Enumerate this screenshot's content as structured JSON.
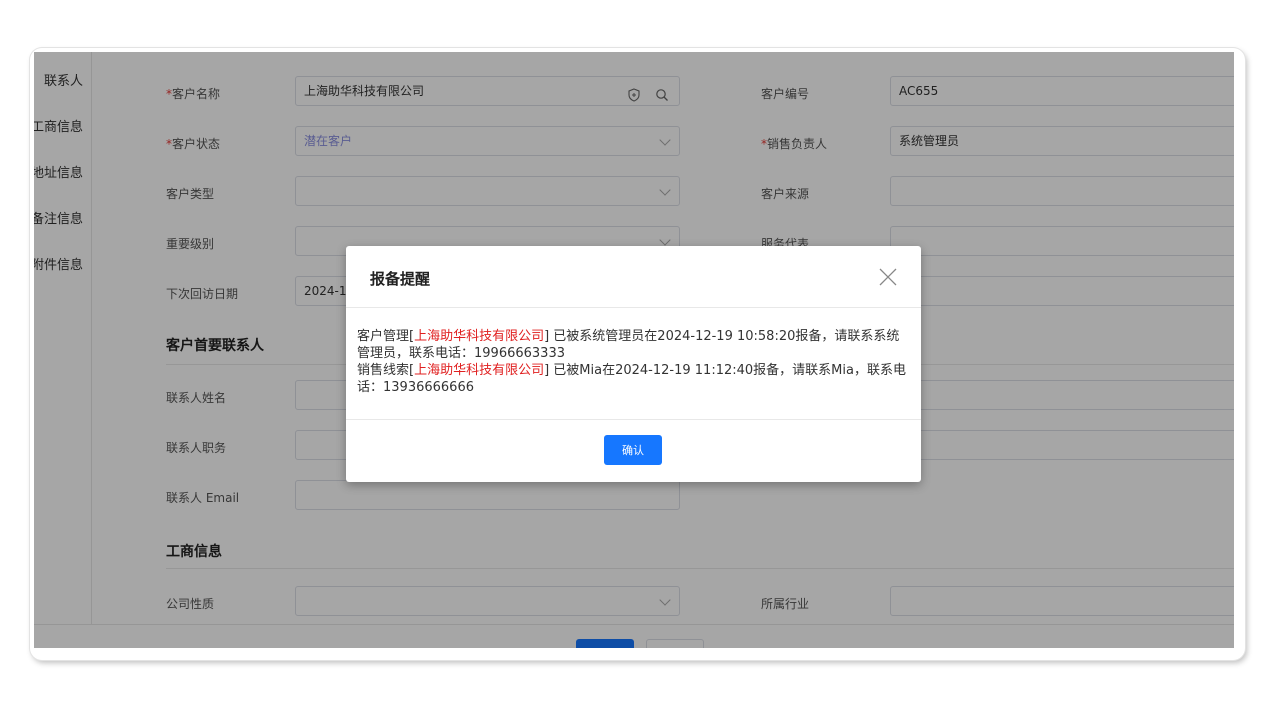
{
  "sidebar": {
    "items": [
      "联系人",
      "工商信息",
      "地址信息",
      "备注信息",
      "附件信息"
    ]
  },
  "form": {
    "customer_name": {
      "label": "客户名称",
      "value": "上海助华科技有限公司"
    },
    "customer_no": {
      "label": "客户编号",
      "value": "AC655"
    },
    "customer_status": {
      "label": "客户状态",
      "value": "潜在客户"
    },
    "sales_owner": {
      "label": "销售负责人",
      "value": "系统管理员"
    },
    "customer_type": {
      "label": "客户类型",
      "value": ""
    },
    "customer_source": {
      "label": "客户来源",
      "value": ""
    },
    "importance": {
      "label": "重要级别",
      "value": ""
    },
    "service_rep": {
      "label": "服务代表",
      "value": ""
    },
    "next_visit": {
      "label": "下次回访日期",
      "value": "2024-12"
    },
    "section_contact": "客户首要联系人",
    "contact_name": {
      "label": "联系人姓名",
      "value": ""
    },
    "contact_title": {
      "label": "联系人职务",
      "value": ""
    },
    "contact_email": {
      "label": "联系人 Email",
      "value": ""
    },
    "section_business": "工商信息",
    "company_nature": {
      "label": "公司性质",
      "value": ""
    },
    "industry": {
      "label": "所属行业",
      "value": ""
    },
    "required_mark": "*"
  },
  "modal": {
    "title": "报备提醒",
    "line1_pre": "客户管理[",
    "line1_company": "上海助华科技有限公司",
    "line1_post": "] 已被系统管理员在2024-12-19 10:58:20报备，请联系系统管理员，联系电话：19966663333",
    "line2_pre": "销售线索[",
    "line2_company": "上海助华科技有限公司",
    "line2_post": "] 已被Mia在2024-12-19 11:12:40报备，请联系Mia，联系电话：13936666666",
    "confirm_label": "确认"
  },
  "colors": {
    "primary": "#1677ff",
    "highlight_red": "#e02020",
    "required_red": "#e53935"
  }
}
